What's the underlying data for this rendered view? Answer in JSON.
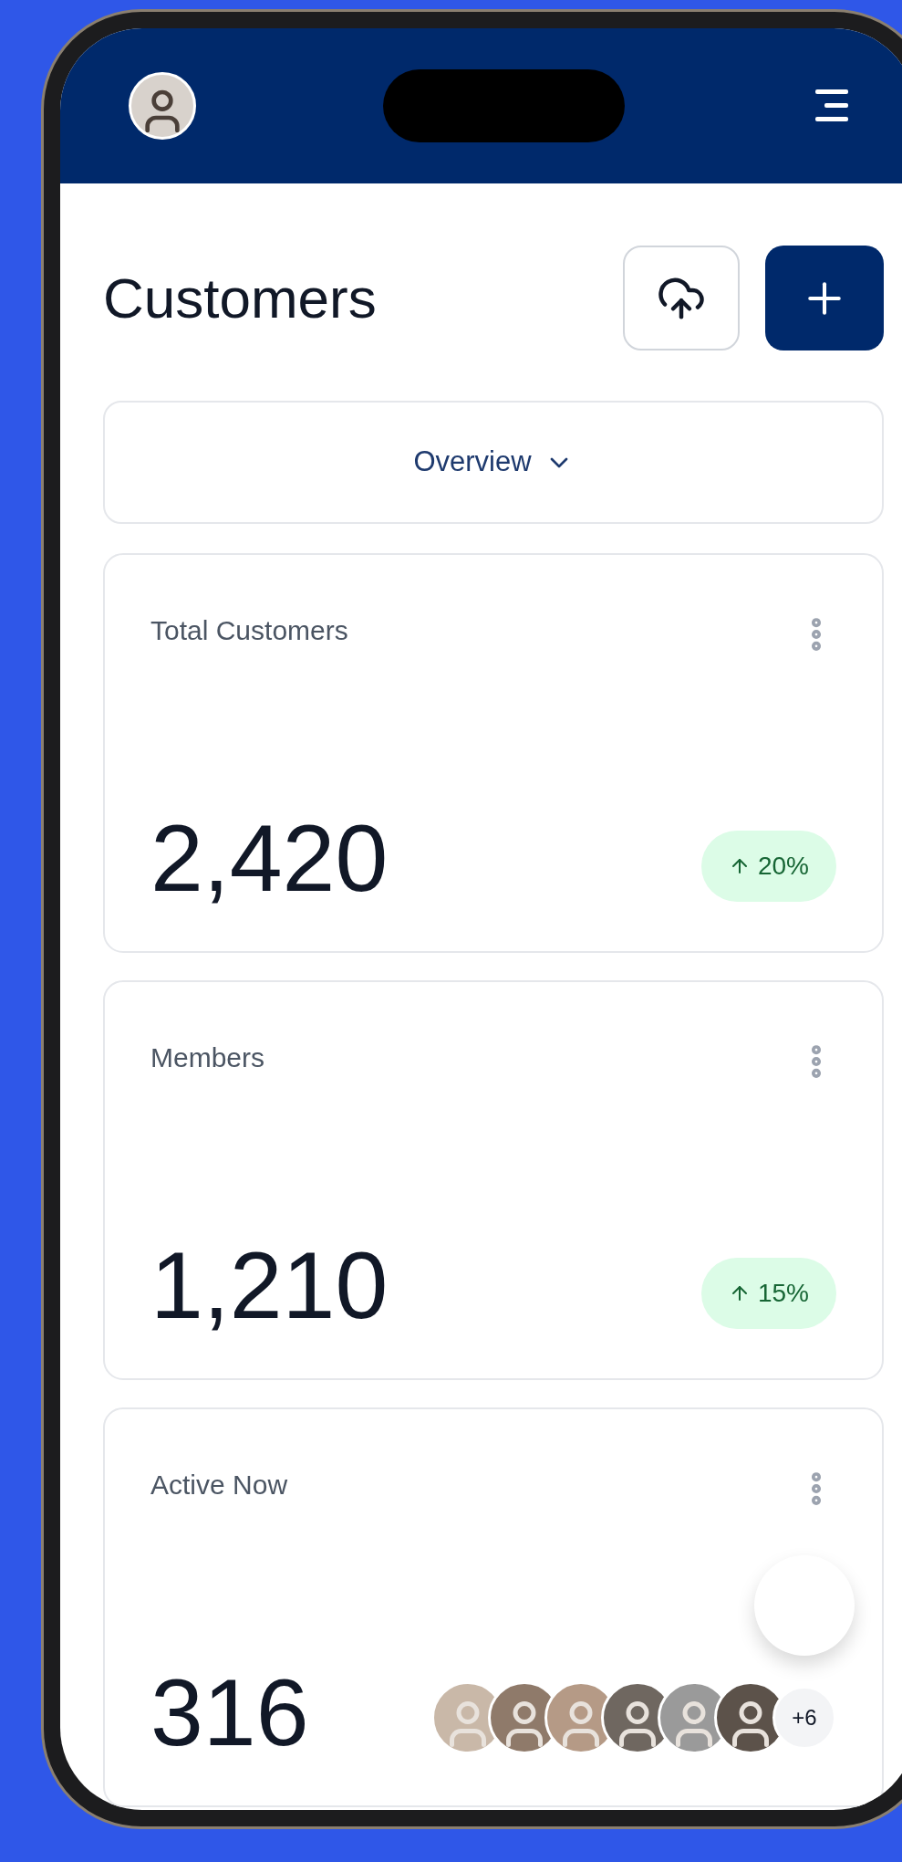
{
  "page": {
    "title": "Customers"
  },
  "view_selector": {
    "label": "Overview"
  },
  "cards": [
    {
      "kind": "trend",
      "title": "Total Customers",
      "value": "2,420",
      "change": "20%"
    },
    {
      "kind": "trend",
      "title": "Members",
      "value": "1,210",
      "change": "15%"
    },
    {
      "kind": "avatars",
      "title": "Active Now",
      "value": "316",
      "more": "+6"
    }
  ]
}
